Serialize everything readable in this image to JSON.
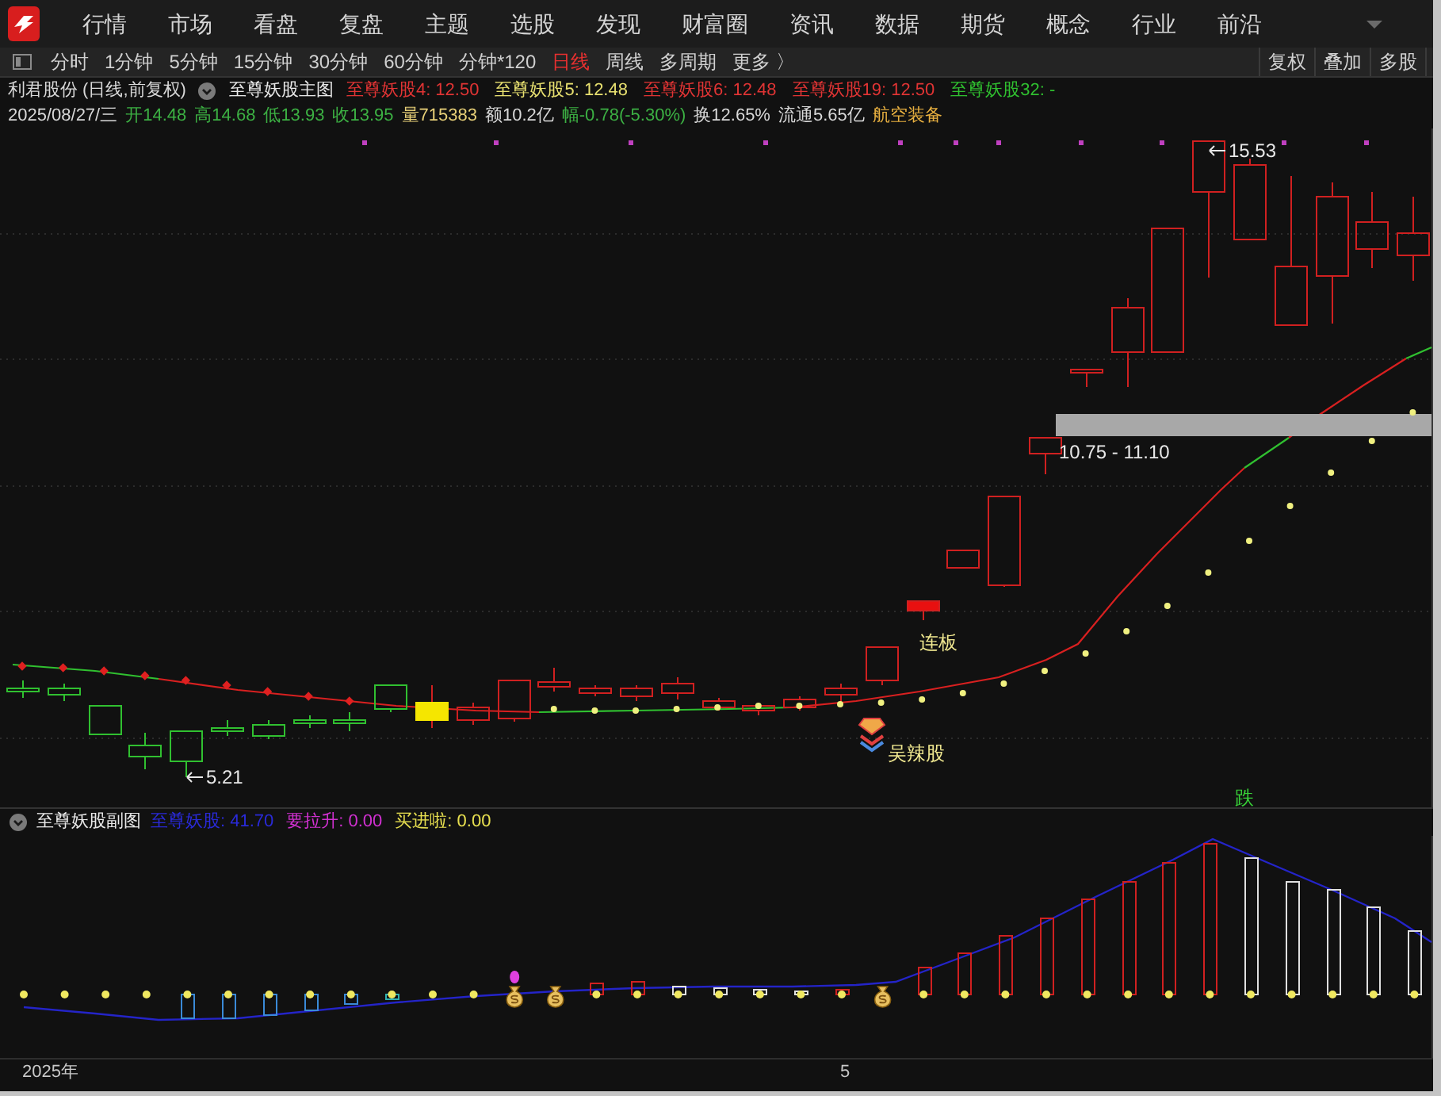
{
  "menu_bar": {
    "items": [
      "行情",
      "市场",
      "看盘",
      "复盘",
      "主题",
      "选股",
      "发现",
      "财富圈",
      "资讯",
      "数据",
      "期货",
      "概念",
      "行业",
      "前沿"
    ]
  },
  "period_bar": {
    "periods": [
      {
        "label": "分时",
        "selected": false
      },
      {
        "label": "1分钟",
        "selected": false
      },
      {
        "label": "5分钟",
        "selected": false
      },
      {
        "label": "15分钟",
        "selected": false
      },
      {
        "label": "30分钟",
        "selected": false
      },
      {
        "label": "60分钟",
        "selected": false
      },
      {
        "label": "分钟*120",
        "selected": false
      },
      {
        "label": "日线",
        "selected": true
      },
      {
        "label": "周线",
        "selected": false
      },
      {
        "label": "多周期",
        "selected": false
      },
      {
        "label": "更多 〉",
        "selected": false
      }
    ],
    "buttons": [
      "复权",
      "叠加",
      "多股"
    ]
  },
  "main_chart": {
    "stock_title": "利君股份 (日线,前复权)",
    "indicator_name": "至尊妖股主图",
    "indicator_values": [
      {
        "text": "至尊妖股4: 12.50",
        "color": "#e03434"
      },
      {
        "text": "至尊妖股5: 12.48",
        "color": "#e8e070"
      },
      {
        "text": "至尊妖股6: 12.48",
        "color": "#e03434"
      },
      {
        "text": "至尊妖股19: 12.50",
        "color": "#e03434"
      },
      {
        "text": "至尊妖股32: -",
        "color": "#30c030"
      }
    ],
    "quote": [
      {
        "text": "2025/08/27/三",
        "color": "#d8d8d8"
      },
      {
        "text": "开14.48",
        "color": "#3cb043"
      },
      {
        "text": "高14.68",
        "color": "#3cb043"
      },
      {
        "text": "低13.93",
        "color": "#3cb043"
      },
      {
        "text": "收13.95",
        "color": "#3cb043"
      },
      {
        "text": "量715383",
        "color": "#e8d078"
      },
      {
        "text": "额10.2亿",
        "color": "#d8d8d8"
      },
      {
        "text": "幅-0.78(-5.30%)",
        "color": "#3cb043"
      },
      {
        "text": "换12.65%",
        "color": "#d8d8d8"
      },
      {
        "text": "流通5.65亿",
        "color": "#d8d8d8"
      },
      {
        "text": "航空装备",
        "color": "#e8b040"
      }
    ],
    "annotations": [
      {
        "kind": "high",
        "text": "15.53"
      },
      {
        "kind": "low",
        "text": "5.21"
      },
      {
        "kind": "range",
        "text": "10.75 - 11.10"
      },
      {
        "kind": "tag",
        "text": "连板"
      },
      {
        "kind": "tag_icon",
        "text": "吴辣股"
      },
      {
        "kind": "alert",
        "text": "跌"
      }
    ]
  },
  "sub_chart": {
    "indicator_name": "至尊妖股副图",
    "indicator_values": [
      {
        "text": "至尊妖股: 41.70",
        "color": "#2a2ad8"
      },
      {
        "text": "要拉升: 0.00",
        "color": "#d030d0"
      },
      {
        "text": "买进啦: 0.00",
        "color": "#e8e050"
      }
    ]
  },
  "time_axis": {
    "labels": [
      "2025年",
      "5"
    ]
  }
}
